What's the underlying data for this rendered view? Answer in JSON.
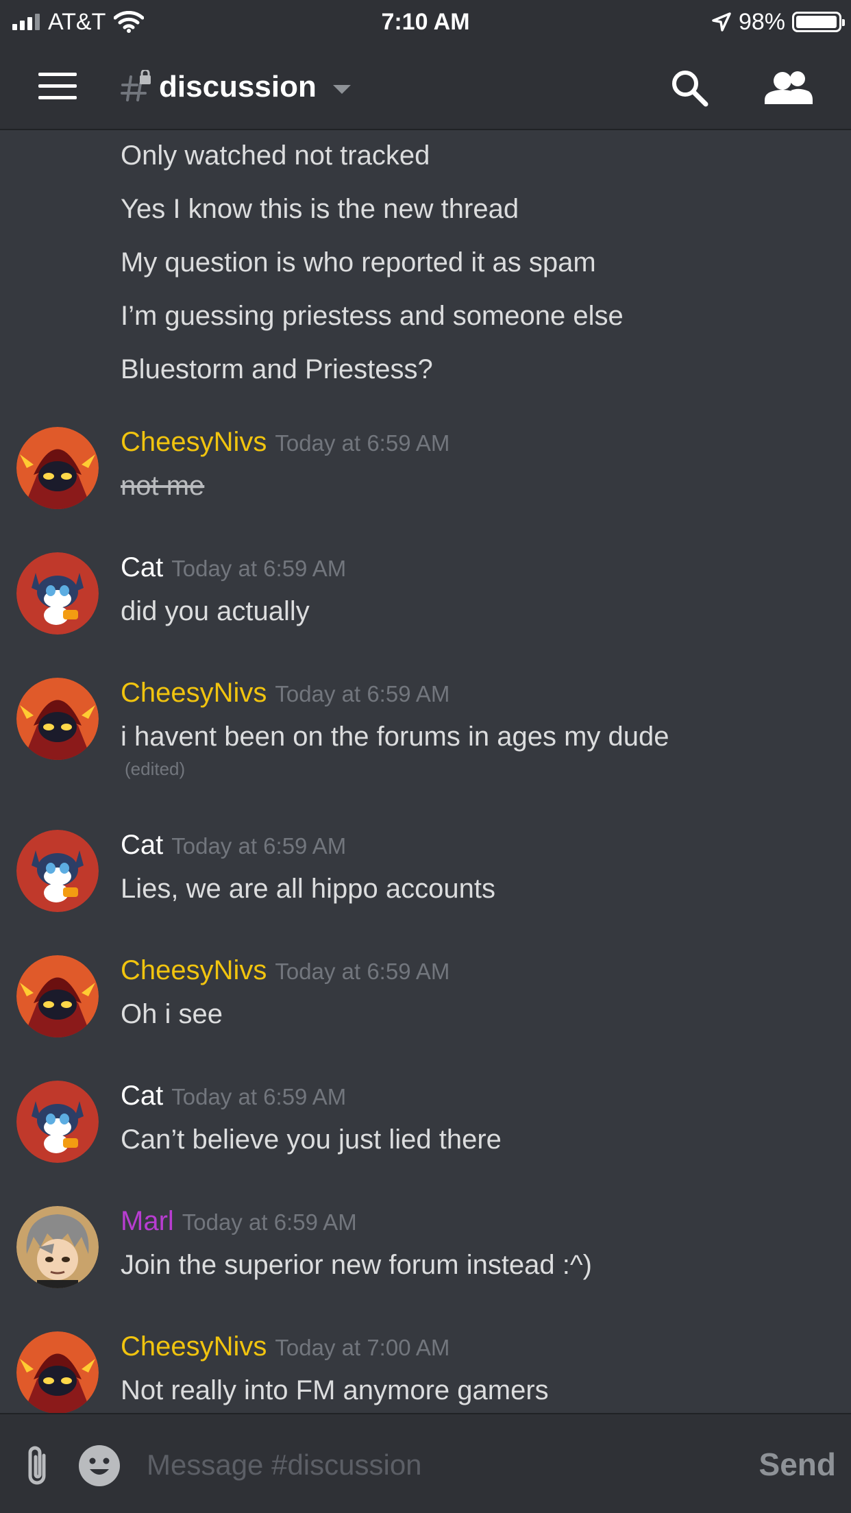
{
  "status_bar": {
    "carrier": "AT&T",
    "time": "7:10 AM",
    "battery": "98%",
    "battery_level": 0.98
  },
  "header": {
    "channel": "discussion"
  },
  "messages": {
    "continuation": [
      "Only watched not tracked",
      "Yes I know this is the new thread",
      "My question is who reported it as spam",
      "I’m guessing priestess and someone else",
      "Bluestorm and Priestess?"
    ],
    "groups": [
      {
        "author": "CheesyNivs",
        "time": "Today at 6:59 AM",
        "text": "not me"
      },
      {
        "author": "Cat",
        "time": "Today at 6:59 AM",
        "text": "did you actually"
      },
      {
        "author": "CheesyNivs",
        "time": "Today at 6:59 AM",
        "text": "i havent been on the forums in ages my dude",
        "edited": "(edited)"
      },
      {
        "author": "Cat",
        "time": "Today at 6:59 AM",
        "text": "Lies, we are all hippo accounts"
      },
      {
        "author": "CheesyNivs",
        "time": "Today at 6:59 AM",
        "text": "Oh i see"
      },
      {
        "author": "Cat",
        "time": "Today at 6:59 AM",
        "text": "Can’t believe you just lied there"
      },
      {
        "author": "Marl",
        "time": "Today at 6:59 AM",
        "text": "Join the superior new forum instead :^)"
      },
      {
        "author": "CheesyNivs",
        "time": "Today at 7:00 AM",
        "text": "Not really into FM anymore gamers"
      }
    ]
  },
  "composer": {
    "placeholder": "Message #discussion",
    "send_label": "Send"
  },
  "colors": {
    "background": "#36393f",
    "header": "#2f3136",
    "cheesynivs": "#f1c40f",
    "cat": "#ffffff",
    "marl": "#b83dd1",
    "text": "#dcddde",
    "muted": "#72767d"
  },
  "icons": {
    "menu": "menu-icon",
    "channel": "locked-hash-icon",
    "search": "search-icon",
    "members": "members-icon",
    "attach": "paperclip-icon",
    "emoji": "emoji-icon"
  }
}
